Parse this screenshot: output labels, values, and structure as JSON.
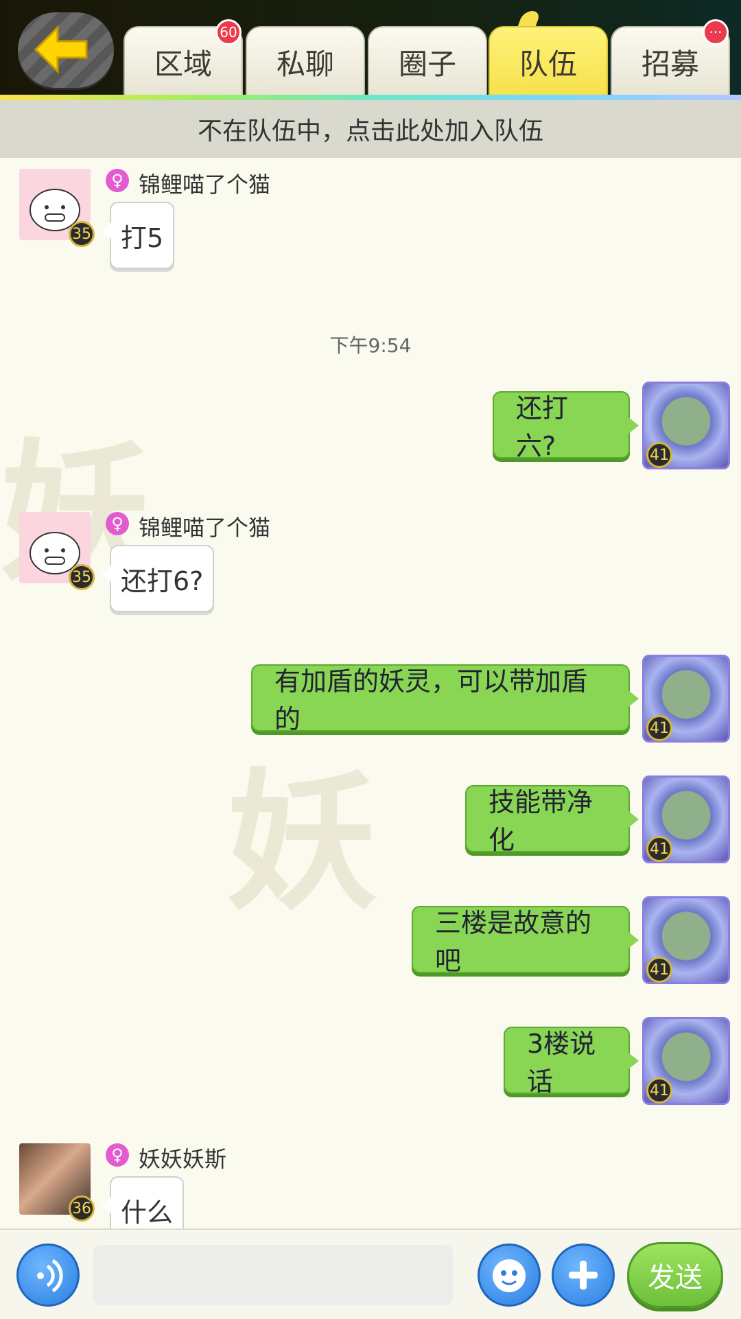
{
  "header": {
    "back_icon": "arrow-left-icon",
    "tabs": [
      {
        "label": "区域",
        "badge": "60"
      },
      {
        "label": "私聊"
      },
      {
        "label": "圈子"
      },
      {
        "label": "队伍",
        "active": true
      },
      {
        "label": "招募",
        "badge": "···"
      }
    ]
  },
  "join_bar": {
    "text": "不在队伍中，点击此处加入队伍"
  },
  "messages": [
    {
      "side": "left",
      "user": "锦鲤喵了个猫",
      "level": "35",
      "text": "打5"
    },
    {
      "type": "time",
      "text": "下午9:54"
    },
    {
      "side": "right",
      "level": "41",
      "text": "还打六?"
    },
    {
      "side": "left",
      "user": "锦鲤喵了个猫",
      "level": "35",
      "text": "还打6?"
    },
    {
      "side": "right",
      "level": "41",
      "text": "有加盾的妖灵，可以带加盾的"
    },
    {
      "side": "right",
      "level": "41",
      "text": "技能带净化"
    },
    {
      "side": "right",
      "level": "41",
      "text": "三楼是故意的吧"
    },
    {
      "side": "right",
      "level": "41",
      "text": "3楼说话"
    },
    {
      "side": "left",
      "user": "妖妖妖斯",
      "level": "36",
      "text": "什么"
    }
  ],
  "bottom": {
    "voice_icon": "voice-icon",
    "input_value": "",
    "emoji_icon": "emoji-icon",
    "plus_icon": "plus-icon",
    "send_label": "发送"
  },
  "colors": {
    "accent_green": "#88d653",
    "tab_active": "#f6e04b",
    "badge_red": "#ec3b4e",
    "gender_pink": "#e35bd0"
  }
}
